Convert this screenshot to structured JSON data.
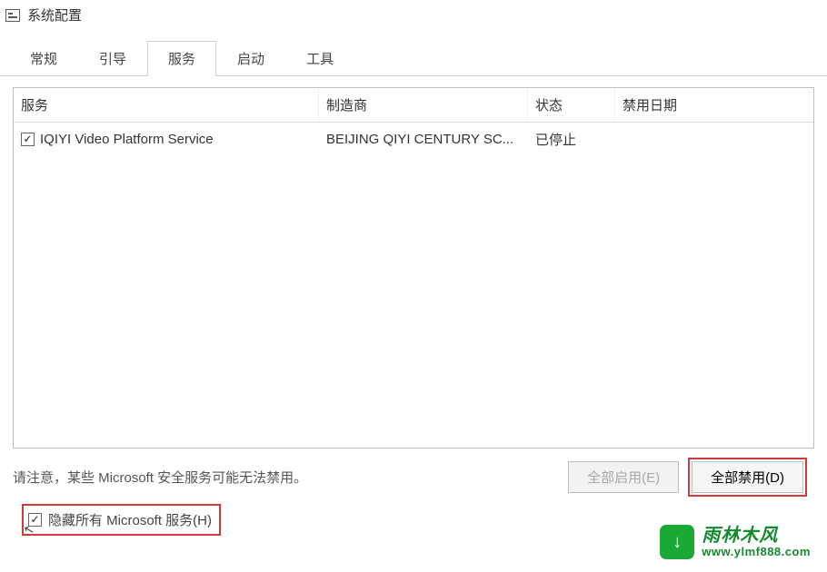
{
  "window": {
    "title": "系统配置"
  },
  "tabs": {
    "general": "常规",
    "boot": "引导",
    "services": "服务",
    "startup": "启动",
    "tools": "工具",
    "active_index": 2
  },
  "table": {
    "headers": {
      "service": "服务",
      "manufacturer": "制造商",
      "status": "状态",
      "disabled_date": "禁用日期"
    },
    "rows": [
      {
        "checked": true,
        "service": "IQIYI Video Platform Service",
        "manufacturer": "BEIJING QIYI CENTURY SC...",
        "status": "已停止",
        "disabled_date": ""
      }
    ]
  },
  "hint": "请注意，某些 Microsoft 安全服务可能无法禁用。",
  "buttons": {
    "enable_all": "全部启用(E)",
    "disable_all": "全部禁用(D)"
  },
  "hide_ms": {
    "label": "隐藏所有 Microsoft 服务(H)",
    "checked": true
  },
  "watermark": {
    "cn": "雨林木风",
    "url": "www.ylmf888.com",
    "badge": "↓"
  }
}
